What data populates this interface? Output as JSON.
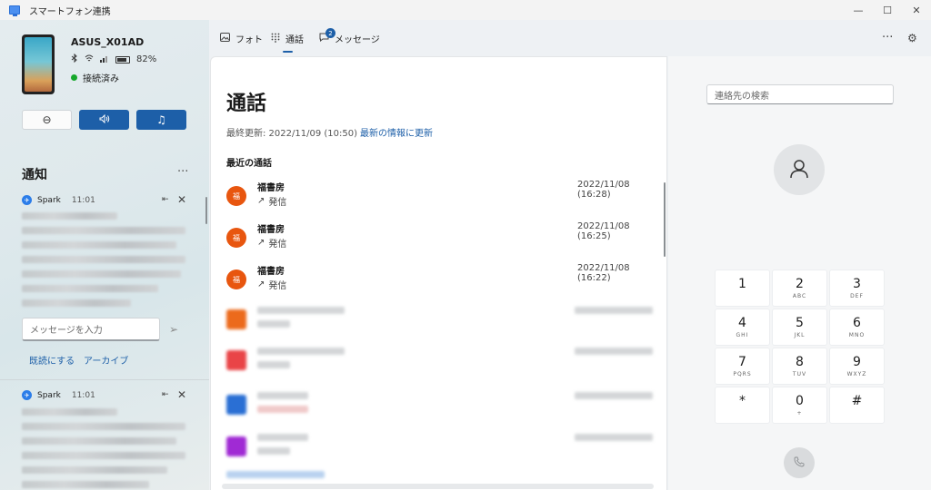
{
  "window": {
    "title": "スマートフォン連携",
    "controls": [
      "—",
      "☐",
      "✕"
    ]
  },
  "device": {
    "name": "ASUS_X01AD",
    "battery": "82%",
    "battery_level": 0.82,
    "status": "接続済み"
  },
  "quick_actions": [
    {
      "icon": "do-not-disturb-icon",
      "glyph": "⊖"
    },
    {
      "icon": "volume-icon",
      "glyph": "🔊"
    },
    {
      "icon": "music-icon",
      "glyph": "♫"
    }
  ],
  "notifications": {
    "title": "通知",
    "more": "···",
    "items": [
      {
        "app": "Spark",
        "time": "11:01"
      },
      {
        "app": "Spark",
        "time": "11:01"
      }
    ],
    "reply_placeholder": "メッセージを入力",
    "mark_read": "既読にする",
    "archive": "アーカイブ"
  },
  "tabs": [
    {
      "label": "フォト",
      "icon": "photo-icon"
    },
    {
      "label": "通話",
      "icon": "dialpad-icon"
    },
    {
      "label": "メッセージ",
      "icon": "message-icon",
      "badge": "2"
    }
  ],
  "toolbar": {
    "more": "···",
    "settings_glyph": "⚙"
  },
  "calls": {
    "title": "通話",
    "last_updated": "最終更新: 2022/11/09 (10:50)",
    "refresh": "最新の情報に更新",
    "recent_title": "最近の通話",
    "items": [
      {
        "avatar": "福",
        "name": "福書房",
        "type": "発信",
        "date": "2022/11/08 (16:28)"
      },
      {
        "avatar": "福",
        "name": "福書房",
        "type": "発信",
        "date": "2022/11/08 (16:25)"
      },
      {
        "avatar": "福",
        "name": "福書房",
        "type": "発信",
        "date": "2022/11/08 (16:22)"
      }
    ]
  },
  "dialer": {
    "search_placeholder": "連絡先の検索",
    "keys": [
      {
        "digit": "1",
        "letters": ""
      },
      {
        "digit": "2",
        "letters": "ABC"
      },
      {
        "digit": "3",
        "letters": "DEF"
      },
      {
        "digit": "4",
        "letters": "GHI"
      },
      {
        "digit": "5",
        "letters": "JKL"
      },
      {
        "digit": "6",
        "letters": "MNO"
      },
      {
        "digit": "7",
        "letters": "PQRS"
      },
      {
        "digit": "8",
        "letters": "TUV"
      },
      {
        "digit": "9",
        "letters": "WXYZ"
      },
      {
        "digit": "*",
        "letters": ""
      },
      {
        "digit": "0",
        "letters": "+"
      },
      {
        "digit": "#",
        "letters": ""
      }
    ]
  },
  "colors": {
    "accent": "#1d5fa8",
    "avatar_orange": "#e8560f",
    "connected_green": "#16a82b"
  }
}
